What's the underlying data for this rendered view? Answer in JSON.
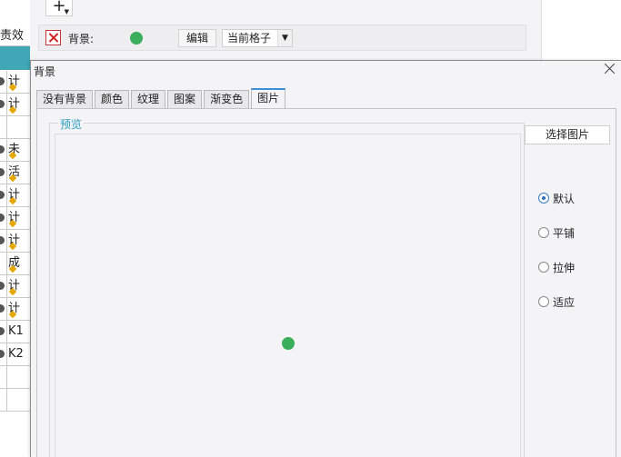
{
  "left_grid": {
    "header": "责效",
    "rows": [
      {
        "text": "计",
        "dot": true,
        "flag": true
      },
      {
        "text": "计",
        "dot": true,
        "flag": true
      },
      {
        "text": "",
        "dot": false,
        "flag": false
      },
      {
        "text": "未",
        "dot": true,
        "flag": true
      },
      {
        "text": "活",
        "dot": true,
        "flag": true
      },
      {
        "text": "计",
        "dot": true,
        "flag": true
      },
      {
        "text": "计",
        "dot": true,
        "flag": true
      },
      {
        "text": "计",
        "dot": true,
        "flag": true
      },
      {
        "text": "成",
        "dot": false,
        "flag": true
      },
      {
        "text": "计",
        "dot": true,
        "flag": true
      },
      {
        "text": "计",
        "dot": true,
        "flag": true
      },
      {
        "text": "K1",
        "dot": true,
        "flag": false
      },
      {
        "text": "K2",
        "dot": true,
        "flag": false
      },
      {
        "text": "",
        "dot": false,
        "flag": false
      },
      {
        "text": "",
        "dot": false,
        "flag": false
      }
    ]
  },
  "top_panel": {
    "add_symbol": "+",
    "background_label": "背景:",
    "background_color": "#3aae5a",
    "edit_button": "编辑",
    "scope_select": "当前格子",
    "delete_icon": "close-x-icon"
  },
  "dialog": {
    "title": "背景",
    "tabs": [
      {
        "label": "没有背景",
        "active": false
      },
      {
        "label": "颜色",
        "active": false
      },
      {
        "label": "纹理",
        "active": false
      },
      {
        "label": "图案",
        "active": false
      },
      {
        "label": "渐变色",
        "active": false
      },
      {
        "label": "图片",
        "active": true
      }
    ],
    "preview_legend": "预览",
    "choose_image_button": "选择图片",
    "layout_options": [
      {
        "label": "默认",
        "checked": true
      },
      {
        "label": "平铺",
        "checked": false
      },
      {
        "label": "拉伸",
        "checked": false
      },
      {
        "label": "适应",
        "checked": false
      }
    ]
  },
  "colors": {
    "accent_blue": "#3b8fd6",
    "legend_teal": "#2a9bbf",
    "grid_teal": "#3fa7b5",
    "green_dot": "#3aae5a",
    "delete_red": "#d32020"
  }
}
